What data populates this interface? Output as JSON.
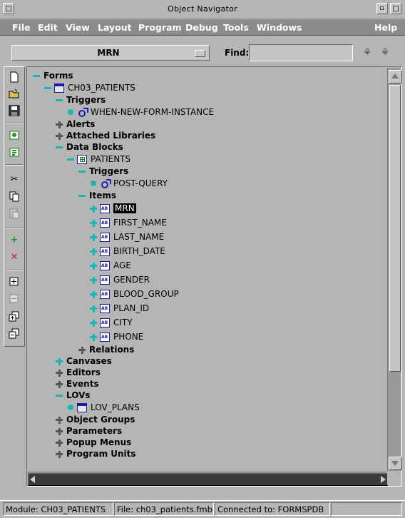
{
  "window": {
    "title": "Object Navigator"
  },
  "menubar": {
    "items": [
      "File",
      "Edit",
      "View",
      "Layout",
      "Program",
      "Debug",
      "Tools",
      "Windows",
      "Help"
    ]
  },
  "toolbar": {
    "module_combo_value": "MRN",
    "find_label": "Find:",
    "find_value": ""
  },
  "toolstrip_icons": [
    "new-icon",
    "open-icon",
    "save-icon",
    "run-form-icon",
    "debug-form-icon",
    "cut-icon",
    "copy-icon",
    "paste-icon",
    "create-icon",
    "delete-icon",
    "expand-icon",
    "collapse-icon",
    "expand-all-icon",
    "collapse-all-icon"
  ],
  "tree": {
    "nodes": [
      {
        "label": "Forms",
        "depth": 0,
        "bold": true,
        "marker": "minus"
      },
      {
        "label": "CH03_PATIENTS",
        "depth": 1,
        "bold": false,
        "marker": "minus",
        "icon": "form"
      },
      {
        "label": "Triggers",
        "depth": 2,
        "bold": true,
        "marker": "minus"
      },
      {
        "label": "WHEN-NEW-FORM-INSTANCE",
        "depth": 3,
        "bold": false,
        "marker": "dot",
        "icon": "trigger"
      },
      {
        "label": "Alerts",
        "depth": 2,
        "bold": true,
        "marker": "plus"
      },
      {
        "label": "Attached Libraries",
        "depth": 2,
        "bold": true,
        "marker": "plus"
      },
      {
        "label": "Data Blocks",
        "depth": 2,
        "bold": true,
        "marker": "minus"
      },
      {
        "label": "PATIENTS",
        "depth": 3,
        "bold": false,
        "marker": "minus",
        "icon": "block"
      },
      {
        "label": "Triggers",
        "depth": 4,
        "bold": true,
        "marker": "minus"
      },
      {
        "label": "POST-QUERY",
        "depth": 5,
        "bold": false,
        "marker": "dot",
        "icon": "trigger"
      },
      {
        "label": "Items",
        "depth": 4,
        "bold": true,
        "marker": "minus"
      },
      {
        "label": "MRN",
        "depth": 5,
        "bold": false,
        "marker": "plus-cyan",
        "icon": "item",
        "selected": true
      },
      {
        "label": "FIRST_NAME",
        "depth": 5,
        "bold": false,
        "marker": "plus-cyan",
        "icon": "item"
      },
      {
        "label": "LAST_NAME",
        "depth": 5,
        "bold": false,
        "marker": "plus-cyan",
        "icon": "item"
      },
      {
        "label": "BIRTH_DATE",
        "depth": 5,
        "bold": false,
        "marker": "plus-cyan",
        "icon": "item"
      },
      {
        "label": "AGE",
        "depth": 5,
        "bold": false,
        "marker": "plus-cyan",
        "icon": "item"
      },
      {
        "label": "GENDER",
        "depth": 5,
        "bold": false,
        "marker": "plus-cyan",
        "icon": "item"
      },
      {
        "label": "BLOOD_GROUP",
        "depth": 5,
        "bold": false,
        "marker": "plus-cyan",
        "icon": "item"
      },
      {
        "label": "PLAN_ID",
        "depth": 5,
        "bold": false,
        "marker": "plus-cyan",
        "icon": "item"
      },
      {
        "label": "CITY",
        "depth": 5,
        "bold": false,
        "marker": "plus-cyan",
        "icon": "item"
      },
      {
        "label": "PHONE",
        "depth": 5,
        "bold": false,
        "marker": "plus-cyan",
        "icon": "item"
      },
      {
        "label": "Relations",
        "depth": 4,
        "bold": true,
        "marker": "plus"
      },
      {
        "label": "Canvases",
        "depth": 2,
        "bold": true,
        "marker": "plus-cyan"
      },
      {
        "label": "Editors",
        "depth": 2,
        "bold": true,
        "marker": "plus"
      },
      {
        "label": "Events",
        "depth": 2,
        "bold": true,
        "marker": "plus"
      },
      {
        "label": "LOVs",
        "depth": 2,
        "bold": true,
        "marker": "minus"
      },
      {
        "label": "LOV_PLANS",
        "depth": 3,
        "bold": false,
        "marker": "dot",
        "icon": "form"
      },
      {
        "label": "Object Groups",
        "depth": 2,
        "bold": true,
        "marker": "plus"
      },
      {
        "label": "Parameters",
        "depth": 2,
        "bold": true,
        "marker": "plus"
      },
      {
        "label": "Popup Menus",
        "depth": 2,
        "bold": true,
        "marker": "plus"
      },
      {
        "label": "Program Units",
        "depth": 2,
        "bold": true,
        "marker": "plus"
      }
    ]
  },
  "statusbar": {
    "module": "Module: CH03_PATIENTS",
    "file": "File: ch03_patients.fmb",
    "connection": "Connected to: FORMSPDB",
    "extra": ""
  }
}
